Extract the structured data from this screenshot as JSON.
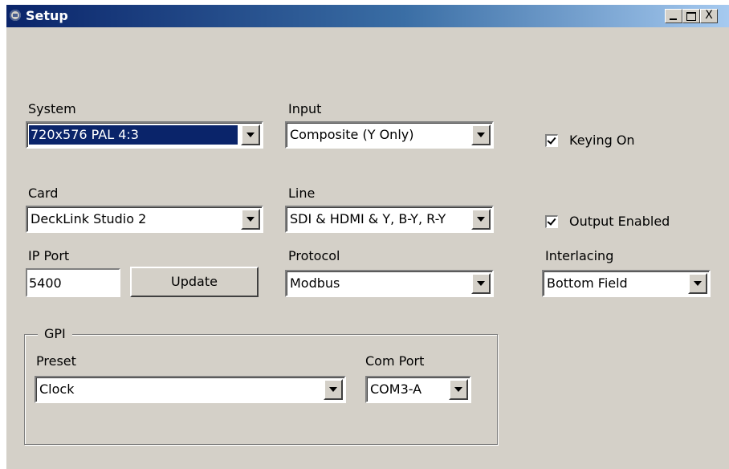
{
  "window": {
    "title": "Setup",
    "controls": {
      "minimize": "_",
      "maximize": "□",
      "close": "X"
    }
  },
  "icons": {
    "app": "app-circle-icon",
    "dropdown": "chevron-down-icon",
    "check": "checkmark-icon"
  },
  "colors": {
    "titlebar_start": "#0a246a",
    "titlebar_end": "#a6caf0",
    "selection": "#0a246a",
    "face": "#d4d0c8"
  },
  "system": {
    "label": "System",
    "value": "720x576 PAL 4:3"
  },
  "input": {
    "label": "Input",
    "value": "Composite (Y Only)"
  },
  "keying": {
    "label": "Keying On",
    "checked": true
  },
  "card": {
    "label": "Card",
    "value": "DeckLink Studio 2"
  },
  "line": {
    "label": "Line",
    "value": "SDI & HDMI & Y, B-Y, R-Y"
  },
  "output": {
    "label": "Output Enabled",
    "checked": true
  },
  "ip_port": {
    "label": "IP Port",
    "value": "5400",
    "update_label": "Update"
  },
  "protocol": {
    "label": "Protocol",
    "value": "Modbus"
  },
  "interlacing": {
    "label": "Interlacing",
    "value": "Bottom Field"
  },
  "gpi": {
    "legend": "GPI",
    "preset": {
      "label": "Preset",
      "value": "Clock"
    },
    "com_port": {
      "label": "Com Port",
      "value": "COM3-A"
    }
  }
}
